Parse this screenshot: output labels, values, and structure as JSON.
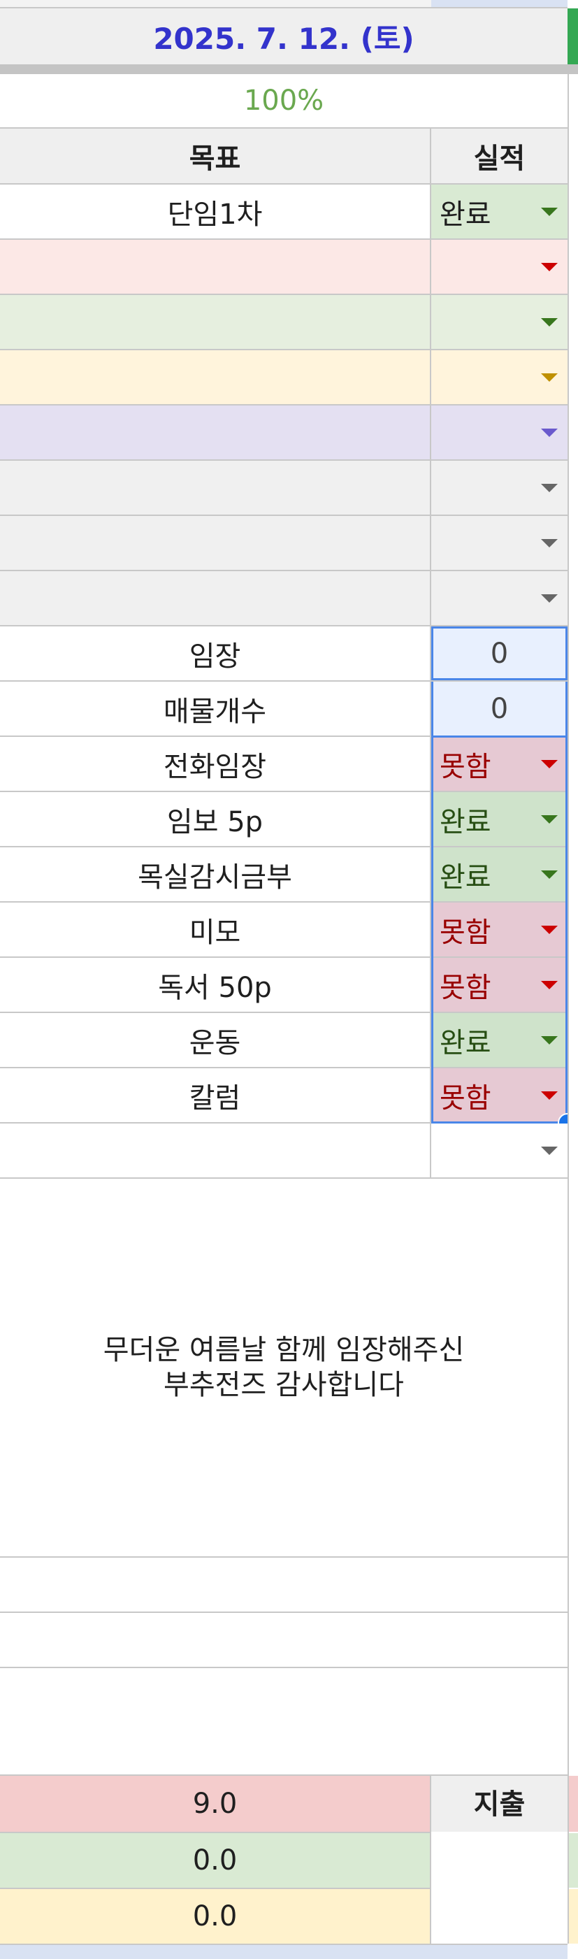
{
  "header": {
    "date": "2025. 7. 12. (토)",
    "progress": "100%",
    "col_goal": "목표",
    "col_result": "실적"
  },
  "rows": [
    {
      "goal": "단임1차",
      "result": "완료"
    },
    {
      "goal": "",
      "result": ""
    },
    {
      "goal": "",
      "result": ""
    },
    {
      "goal": "",
      "result": ""
    },
    {
      "goal": "",
      "result": ""
    },
    {
      "goal": "",
      "result": ""
    },
    {
      "goal": "",
      "result": ""
    },
    {
      "goal": "",
      "result": ""
    },
    {
      "goal": "임장",
      "result": "0"
    },
    {
      "goal": "매물개수",
      "result": "0"
    },
    {
      "goal": "전화임장",
      "result": "못함"
    },
    {
      "goal": "임보 5p",
      "result": "완료"
    },
    {
      "goal": "목실감시금부",
      "result": "완료"
    },
    {
      "goal": "미모",
      "result": "못함"
    },
    {
      "goal": "독서 50p",
      "result": "못함"
    },
    {
      "goal": "운동",
      "result": "완료"
    },
    {
      "goal": "칼럼",
      "result": "못함"
    },
    {
      "goal": "",
      "result": ""
    }
  ],
  "memo": {
    "line1": "무더운 여름날 함께 임장해주신",
    "line2": "부추전즈 감사합니다"
  },
  "totals": {
    "v1": "9.0",
    "v2": "0.0",
    "v3": "0.0",
    "expense_label": "지출"
  },
  "colors": {
    "date_text": "#3333cc",
    "progress_text": "#6aa84f",
    "done_bg": "#d9ead3",
    "fail_bg": "#ead1dc",
    "selection": "#1a73e8"
  }
}
